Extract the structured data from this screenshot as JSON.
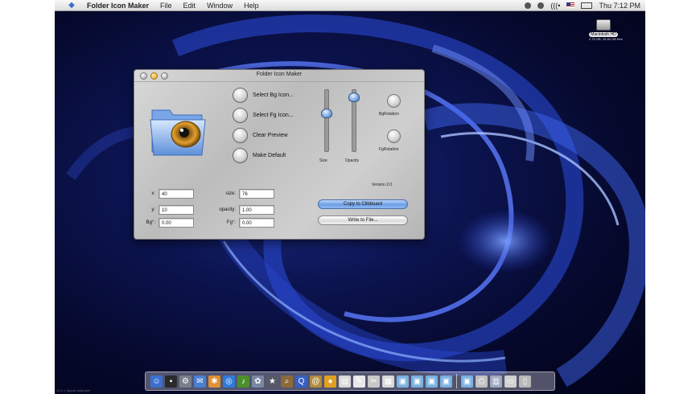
{
  "menubar": {
    "apple_icon": "apple-icon",
    "items": [
      "Folder Icon Maker",
      "File",
      "Edit",
      "Window",
      "Help"
    ],
    "status_right": {
      "lang": "(((•",
      "clock": "Thu 7:12 PM"
    }
  },
  "desktop": {
    "drive": {
      "label": "Macintosh HD",
      "sub": "2.75 GB, 15.50 GB free"
    },
    "credit": "10.2.x Jaguar wallpaper"
  },
  "window": {
    "title": "Folder Icon Maker",
    "buttons": [
      {
        "label": "Select Bg Icon..."
      },
      {
        "label": "Select Fg Icon..."
      },
      {
        "label": "Clear Preview"
      },
      {
        "label": "Make Default"
      }
    ],
    "sliders": [
      {
        "label": "Size",
        "value": 0.35
      },
      {
        "label": "Opacity",
        "value": 0.05
      }
    ],
    "rotate": [
      {
        "label": "BgRotation"
      },
      {
        "label": "FgRotation"
      }
    ],
    "version": "Version 2.0",
    "fields": {
      "x": {
        "label": "x:",
        "value": "40"
      },
      "y": {
        "label": "y:",
        "value": "10"
      },
      "bg": {
        "label": "Bg°:",
        "value": "0.00"
      },
      "size": {
        "label": "size:",
        "value": "76"
      },
      "opacity": {
        "label": "opacity:",
        "value": "1.00"
      },
      "fg": {
        "label": "Fg°:",
        "value": "0.00"
      }
    },
    "copy_button": "Copy to Clibboard",
    "write_button": "Write to File..."
  },
  "dock": {
    "icons": [
      {
        "name": "finder-icon",
        "glyph": "☺",
        "color": "#3b6fd0"
      },
      {
        "name": "terminal-icon",
        "glyph": "▪",
        "color": "#2a2a2a"
      },
      {
        "name": "system-preferences-icon",
        "glyph": "⚙",
        "color": "#7a7f8c"
      },
      {
        "name": "mail-icon",
        "glyph": "✉",
        "color": "#4a7fd0"
      },
      {
        "name": "ichat-icon",
        "glyph": "✱",
        "color": "#e09030"
      },
      {
        "name": "safari-icon",
        "glyph": "◎",
        "color": "#2f7ad8"
      },
      {
        "name": "itunes-icon",
        "glyph": "♪",
        "color": "#4c8f2a"
      },
      {
        "name": "iphoto-icon",
        "glyph": "✿",
        "color": "#7a88a0"
      },
      {
        "name": "imovie-icon",
        "glyph": "★",
        "color": "#555a66"
      },
      {
        "name": "sherlock-icon",
        "glyph": "⌕",
        "color": "#8a6a3a"
      },
      {
        "name": "quicktime-icon",
        "glyph": "Q",
        "color": "#3a5fc0"
      },
      {
        "name": "addressbook-icon",
        "glyph": "@",
        "color": "#b08a40"
      },
      {
        "name": "folder-icon-maker-icon",
        "glyph": "●",
        "color": "#e0a020"
      },
      {
        "name": "preview-icon",
        "glyph": "▤",
        "color": "#d8d8d8"
      },
      {
        "name": "textedit-icon",
        "glyph": "✎",
        "color": "#e8e8e8"
      },
      {
        "name": "script-editor-icon",
        "glyph": "✂",
        "color": "#c8c8c8"
      },
      {
        "name": "calendar-icon",
        "glyph": "▦",
        "color": "#d8d8d8"
      },
      {
        "name": "applications-folder-icon",
        "glyph": "▣",
        "color": "#7ab0e0"
      },
      {
        "name": "documents-folder-icon",
        "glyph": "▣",
        "color": "#7ab0e0"
      },
      {
        "name": "pictures-folder-icon",
        "glyph": "▣",
        "color": "#7ab0e0"
      },
      {
        "name": "movies-folder-icon",
        "glyph": "▣",
        "color": "#7ab0e0"
      },
      {
        "name": "music-folder-icon",
        "glyph": "▣",
        "color": "#7ab0e0"
      },
      {
        "name": "printer-icon",
        "glyph": "⎙",
        "color": "#c0c0c0"
      },
      {
        "name": "network-icon",
        "glyph": "▥",
        "color": "#a0a8c0"
      },
      {
        "name": "monitor-icon",
        "glyph": "▭",
        "color": "#d0d0d0"
      },
      {
        "name": "trash-icon",
        "glyph": "▯",
        "color": "#b8b8b8"
      }
    ]
  }
}
